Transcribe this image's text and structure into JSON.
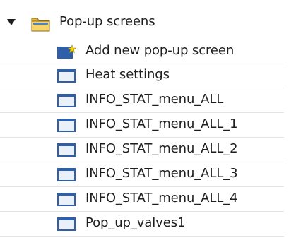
{
  "tree": {
    "root": {
      "label": "Pop-up screens",
      "expanded": true,
      "icon": "folder-icon"
    },
    "items": [
      {
        "label": "Add new pop-up screen",
        "icon": "add-screen-icon"
      },
      {
        "label": "Heat settings",
        "icon": "screen-icon"
      },
      {
        "label": "INFO_STAT_menu_ALL",
        "icon": "screen-icon"
      },
      {
        "label": "INFO_STAT_menu_ALL_1",
        "icon": "screen-icon"
      },
      {
        "label": "INFO_STAT_menu_ALL_2",
        "icon": "screen-icon"
      },
      {
        "label": "INFO_STAT_menu_ALL_3",
        "icon": "screen-icon"
      },
      {
        "label": "INFO_STAT_menu_ALL_4",
        "icon": "screen-icon"
      },
      {
        "label": "Pop_up_valves1",
        "icon": "screen-icon"
      }
    ]
  },
  "colors": {
    "screen_frame": "#2f5fa8",
    "screen_title": "#3a6fbf",
    "screen_body": "#e9f0fa",
    "folder": "#f3c64a",
    "star": "#f4d300"
  }
}
